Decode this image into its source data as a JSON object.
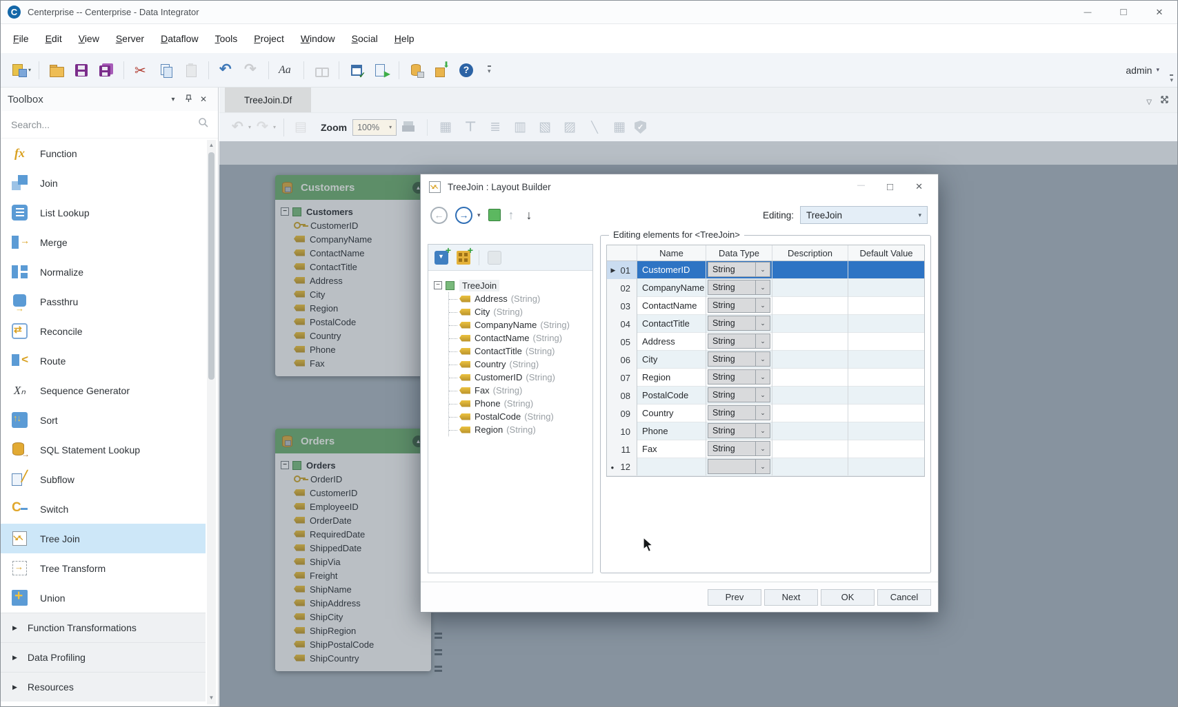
{
  "window": {
    "logo_letter": "C",
    "title": "Centerprise -- Centerprise - Data Integrator",
    "controls": [
      "minimize-icon",
      "maximize-icon",
      "close-icon"
    ]
  },
  "menu": {
    "items": [
      {
        "label": "File"
      },
      {
        "label": "Edit"
      },
      {
        "label": "View"
      },
      {
        "label": "Server"
      },
      {
        "label": "Dataflow"
      },
      {
        "label": "Tools"
      },
      {
        "label": "Project"
      },
      {
        "label": "Window"
      },
      {
        "label": "Social"
      },
      {
        "label": "Help"
      }
    ]
  },
  "toolbar": {
    "admin_label": "admin",
    "buttons": [
      {
        "icon": "new-dataflow-icon",
        "dropdown": true
      },
      {
        "icon": "toolbar-separator",
        "separator": true
      },
      {
        "icon": "open-folder-icon"
      },
      {
        "icon": "save-icon"
      },
      {
        "icon": "save-all-icon"
      },
      {
        "icon": "toolbar-separator",
        "separator": true
      },
      {
        "icon": "cut-icon"
      },
      {
        "icon": "copy-icon"
      },
      {
        "icon": "paste-icon",
        "disabled": true
      },
      {
        "icon": "toolbar-separator",
        "separator": true
      },
      {
        "icon": "undo-icon"
      },
      {
        "icon": "redo-icon",
        "disabled": true
      },
      {
        "icon": "toolbar-separator",
        "separator": true
      },
      {
        "icon": "font-icon"
      },
      {
        "icon": "toolbar-separator",
        "separator": true
      },
      {
        "icon": "find-icon",
        "disabled": true
      },
      {
        "icon": "toolbar-separator",
        "separator": true
      },
      {
        "icon": "verify-window-icon"
      },
      {
        "icon": "run-dataflow-icon"
      },
      {
        "icon": "toolbar-separator",
        "separator": true
      },
      {
        "icon": "db-attach-icon"
      },
      {
        "icon": "deploy-icon"
      },
      {
        "icon": "help-icon"
      },
      {
        "icon": "overflow-icon"
      }
    ]
  },
  "toolbox": {
    "title": "Toolbox",
    "search_placeholder": "Search...",
    "items": [
      {
        "icon": "function-icon",
        "label": "Function"
      },
      {
        "icon": "join-icon",
        "label": "Join"
      },
      {
        "icon": "list-lookup-icon",
        "label": "List Lookup"
      },
      {
        "icon": "merge-icon",
        "label": "Merge"
      },
      {
        "icon": "normalize-icon",
        "label": "Normalize"
      },
      {
        "icon": "passthru-icon",
        "label": "Passthru"
      },
      {
        "icon": "reconcile-icon",
        "label": "Reconcile"
      },
      {
        "icon": "route-icon",
        "label": "Route"
      },
      {
        "icon": "sequence-generator-icon",
        "label": "Sequence Generator"
      },
      {
        "icon": "sort-icon",
        "label": "Sort"
      },
      {
        "icon": "sql-statement-lookup-icon",
        "label": "SQL Statement Lookup"
      },
      {
        "icon": "subflow-icon",
        "label": "Subflow"
      },
      {
        "icon": "switch-icon",
        "label": "Switch"
      },
      {
        "icon": "tree-join-icon",
        "label": "Tree Join",
        "selected": true
      },
      {
        "icon": "tree-transform-icon",
        "label": "Tree Transform"
      },
      {
        "icon": "union-icon",
        "label": "Union"
      }
    ],
    "groups": [
      {
        "label": "Function Transformations"
      },
      {
        "label": "Data Profiling"
      },
      {
        "label": "Resources"
      }
    ]
  },
  "document": {
    "tab_label": "TreeJoin.Df",
    "zoom_label": "Zoom",
    "zoom_value": "100%",
    "doc_toolbar_left": [
      {
        "icon": "undo2-icon",
        "dropdown": true,
        "disabled": true
      },
      {
        "icon": "redo2-icon",
        "dropdown": true,
        "disabled": true
      },
      {
        "icon": "toolbar-separator",
        "separator": true
      },
      {
        "icon": "layout-select-icon",
        "disabled": true
      }
    ],
    "doc_toolbar_right": [
      {
        "icon": "print-icon",
        "disabled": true
      },
      {
        "icon": "toolbar-separator",
        "separator": true
      },
      {
        "icon": "auto-layout-icon",
        "disabled": true
      },
      {
        "icon": "horizontal-layout-icon",
        "disabled": true
      },
      {
        "icon": "list-order-icon",
        "disabled": true
      },
      {
        "icon": "expand-node-icon",
        "disabled": true
      },
      {
        "icon": "expand-in-icon",
        "disabled": true
      },
      {
        "icon": "expand-out-icon",
        "disabled": true
      },
      {
        "icon": "link-tool-icon",
        "disabled": true
      },
      {
        "icon": "preview-grid-icon",
        "disabled": true
      },
      {
        "icon": "verify-shield-icon",
        "disabled": true
      }
    ]
  },
  "canvas": {
    "customers": {
      "title": "Customers",
      "root": "Customers",
      "fields": [
        {
          "icon": "key-icon",
          "name": "CustomerID"
        },
        {
          "icon": "tag-icon",
          "name": "CompanyName"
        },
        {
          "icon": "tag-icon",
          "name": "ContactName"
        },
        {
          "icon": "tag-icon",
          "name": "ContactTitle"
        },
        {
          "icon": "tag-icon",
          "name": "Address"
        },
        {
          "icon": "tag-icon",
          "name": "City"
        },
        {
          "icon": "tag-icon",
          "name": "Region"
        },
        {
          "icon": "tag-icon",
          "name": "PostalCode"
        },
        {
          "icon": "tag-icon",
          "name": "Country"
        },
        {
          "icon": "tag-icon",
          "name": "Phone"
        },
        {
          "icon": "tag-icon",
          "name": "Fax"
        }
      ]
    },
    "orders": {
      "title": "Orders",
      "root": "Orders",
      "fields": [
        {
          "icon": "key-icon",
          "name": "OrderID"
        },
        {
          "icon": "tag-icon",
          "name": "CustomerID"
        },
        {
          "icon": "tag-icon",
          "name": "EmployeeID"
        },
        {
          "icon": "tag-icon",
          "name": "OrderDate"
        },
        {
          "icon": "tag-icon",
          "name": "RequiredDate"
        },
        {
          "icon": "tag-icon",
          "name": "ShippedDate"
        },
        {
          "icon": "tag-icon",
          "name": "ShipVia"
        },
        {
          "icon": "tag-icon",
          "name": "Freight"
        },
        {
          "icon": "tag-icon",
          "name": "ShipName"
        },
        {
          "icon": "tag-icon",
          "name": "ShipAddress"
        },
        {
          "icon": "tag-icon",
          "name": "ShipCity"
        },
        {
          "icon": "tag-icon",
          "name": "ShipRegion"
        },
        {
          "icon": "tag-icon",
          "name": "ShipPostalCode"
        },
        {
          "icon": "tag-icon",
          "name": "ShipCountry"
        }
      ]
    }
  },
  "dialog": {
    "title": "TreeJoin : Layout Builder",
    "editing_label": "Editing:",
    "editing_value": "TreeJoin",
    "tree": {
      "root_label": "TreeJoin",
      "children": [
        {
          "name": "Address",
          "type": "(String)"
        },
        {
          "name": "City",
          "type": "(String)"
        },
        {
          "name": "CompanyName",
          "type": "(String)"
        },
        {
          "name": "ContactName",
          "type": "(String)"
        },
        {
          "name": "ContactTitle",
          "type": "(String)"
        },
        {
          "name": "Country",
          "type": "(String)"
        },
        {
          "name": "CustomerID",
          "type": "(String)"
        },
        {
          "name": "Fax",
          "type": "(String)"
        },
        {
          "name": "Phone",
          "type": "(String)"
        },
        {
          "name": "PostalCode",
          "type": "(String)"
        },
        {
          "name": "Region",
          "type": "(String)"
        }
      ]
    },
    "groupbox_title": "Editing elements for <TreeJoin>",
    "table": {
      "columns": [
        "Name",
        "Data Type",
        "Description",
        "Default Value"
      ],
      "rows": [
        {
          "num": "01",
          "name": "CustomerID",
          "type": "String",
          "selected": true
        },
        {
          "num": "02",
          "name": "CompanyName",
          "type": "String"
        },
        {
          "num": "03",
          "name": "ContactName",
          "type": "String"
        },
        {
          "num": "04",
          "name": "ContactTitle",
          "type": "String"
        },
        {
          "num": "05",
          "name": "Address",
          "type": "String"
        },
        {
          "num": "06",
          "name": "City",
          "type": "String"
        },
        {
          "num": "07",
          "name": "Region",
          "type": "String"
        },
        {
          "num": "08",
          "name": "PostalCode",
          "type": "String"
        },
        {
          "num": "09",
          "name": "Country",
          "type": "String"
        },
        {
          "num": "10",
          "name": "Phone",
          "type": "String"
        },
        {
          "num": "11",
          "name": "Fax",
          "type": "String"
        },
        {
          "num": "12",
          "name": "",
          "type": "",
          "new_row": true
        }
      ]
    },
    "buttons": [
      {
        "label": "Prev"
      },
      {
        "label": "Next"
      },
      {
        "label": "OK"
      },
      {
        "label": "Cancel"
      }
    ]
  }
}
